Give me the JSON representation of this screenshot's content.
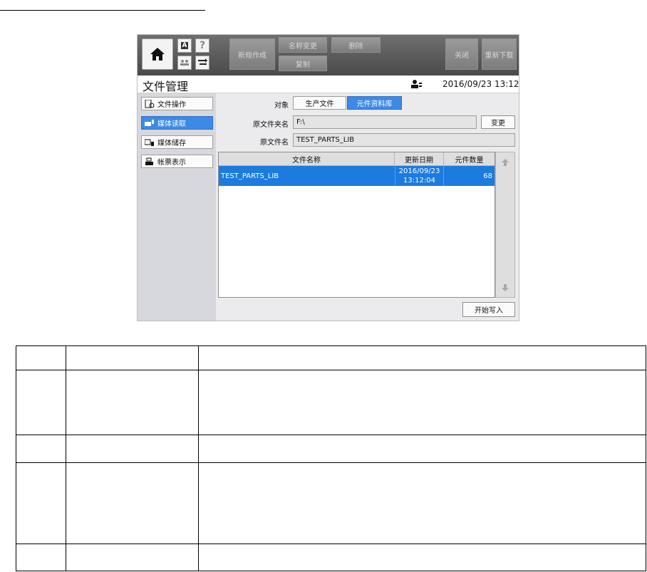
{
  "toolbar": {
    "new_label": "新规作成",
    "rename_label": "名称变更",
    "delete_label": "删除",
    "copy_label": "复制",
    "close_label": "关闭",
    "reload_label": "重新下载",
    "small_a_label": "A",
    "help_label": "?"
  },
  "header": {
    "title": "文件管理",
    "datetime": "2016/09/23 13:12"
  },
  "sidebar": {
    "items": [
      {
        "label": "文件操作",
        "icon": "file-ops-icon",
        "active": false
      },
      {
        "label": "媒体读取",
        "icon": "media-read-icon",
        "active": true
      },
      {
        "label": "媒体储存",
        "icon": "media-save-icon",
        "active": false
      },
      {
        "label": "帐票表示",
        "icon": "report-print-icon",
        "active": false
      }
    ]
  },
  "main": {
    "target_label": "对象",
    "target_options": [
      "生产文件",
      "元件资料库"
    ],
    "target_selected": "元件资料库",
    "folder_label": "原文件夹名",
    "folder_value": "F:\\",
    "change_label": "变更",
    "file_label": "原文件名",
    "file_value": "TEST_PARTS_LIB",
    "table": {
      "columns": [
        "文件名称",
        "更新日期",
        "元件数量"
      ],
      "rows": [
        {
          "name": "TEST_PARTS_LIB",
          "date": "2016/09/23",
          "time": "13:12:04",
          "count": "68",
          "selected": true
        }
      ]
    },
    "start_write_label": "开始写入"
  },
  "colors": {
    "accent": "#3d8ae6",
    "selected_row": "#1c7bdf",
    "toolbar_bg": "#5a5a5a"
  }
}
